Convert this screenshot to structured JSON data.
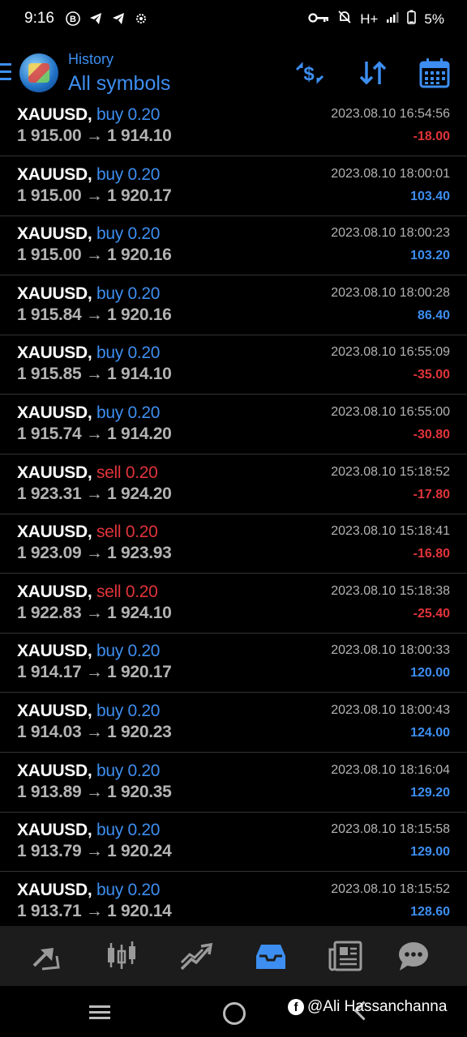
{
  "status_bar": {
    "time": "9:16",
    "network": "H+",
    "battery": "5%"
  },
  "header": {
    "subtitle": "History",
    "title": "All symbols"
  },
  "trades": [
    {
      "symbol": "XAUUSD,",
      "side": "buy",
      "volume": "0.20",
      "open": "1 915.00",
      "close": "1 914.10",
      "time": "2023.08.10 16:54:56",
      "profit": "-18.00"
    },
    {
      "symbol": "XAUUSD,",
      "side": "buy",
      "volume": "0.20",
      "open": "1 915.00",
      "close": "1 920.17",
      "time": "2023.08.10 18:00:01",
      "profit": "103.40"
    },
    {
      "symbol": "XAUUSD,",
      "side": "buy",
      "volume": "0.20",
      "open": "1 915.00",
      "close": "1 920.16",
      "time": "2023.08.10 18:00:23",
      "profit": "103.20"
    },
    {
      "symbol": "XAUUSD,",
      "side": "buy",
      "volume": "0.20",
      "open": "1 915.84",
      "close": "1 920.16",
      "time": "2023.08.10 18:00:28",
      "profit": "86.40"
    },
    {
      "symbol": "XAUUSD,",
      "side": "buy",
      "volume": "0.20",
      "open": "1 915.85",
      "close": "1 914.10",
      "time": "2023.08.10 16:55:09",
      "profit": "-35.00"
    },
    {
      "symbol": "XAUUSD,",
      "side": "buy",
      "volume": "0.20",
      "open": "1 915.74",
      "close": "1 914.20",
      "time": "2023.08.10 16:55:00",
      "profit": "-30.80"
    },
    {
      "symbol": "XAUUSD,",
      "side": "sell",
      "volume": "0.20",
      "open": "1 923.31",
      "close": "1 924.20",
      "time": "2023.08.10 15:18:52",
      "profit": "-17.80"
    },
    {
      "symbol": "XAUUSD,",
      "side": "sell",
      "volume": "0.20",
      "open": "1 923.09",
      "close": "1 923.93",
      "time": "2023.08.10 15:18:41",
      "profit": "-16.80"
    },
    {
      "symbol": "XAUUSD,",
      "side": "sell",
      "volume": "0.20",
      "open": "1 922.83",
      "close": "1 924.10",
      "time": "2023.08.10 15:18:38",
      "profit": "-25.40"
    },
    {
      "symbol": "XAUUSD,",
      "side": "buy",
      "volume": "0.20",
      "open": "1 914.17",
      "close": "1 920.17",
      "time": "2023.08.10 18:00:33",
      "profit": "120.00"
    },
    {
      "symbol": "XAUUSD,",
      "side": "buy",
      "volume": "0.20",
      "open": "1 914.03",
      "close": "1 920.23",
      "time": "2023.08.10 18:00:43",
      "profit": "124.00"
    },
    {
      "symbol": "XAUUSD,",
      "side": "buy",
      "volume": "0.20",
      "open": "1 913.89",
      "close": "1 920.35",
      "time": "2023.08.10 18:16:04",
      "profit": "129.20"
    },
    {
      "symbol": "XAUUSD,",
      "side": "buy",
      "volume": "0.20",
      "open": "1 913.79",
      "close": "1 920.24",
      "time": "2023.08.10 18:15:58",
      "profit": "129.00"
    },
    {
      "symbol": "XAUUSD,",
      "side": "buy",
      "volume": "0.20",
      "open": "1 913.71",
      "close": "1 920.14",
      "time": "2023.08.10 18:15:52",
      "profit": "128.60"
    }
  ],
  "bottom_nav": {
    "items": [
      "quotes-icon",
      "chart-icon",
      "trade-icon",
      "history-icon",
      "news-icon",
      "chat-icon"
    ],
    "active": "history-icon",
    "active_color": "#3d8ef0"
  },
  "watermark": {
    "text": "@Ali Hassanchanna"
  },
  "colors": {
    "accent": "#3d8ef0",
    "loss": "#e0343a",
    "background": "#000000"
  }
}
